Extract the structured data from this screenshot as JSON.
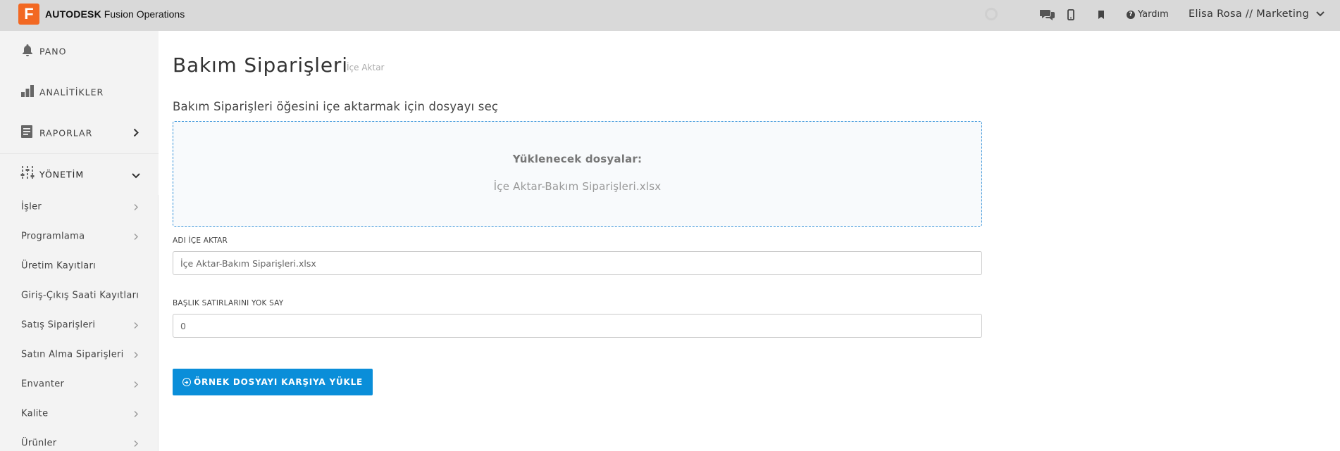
{
  "topbar": {
    "logo_letter": "F",
    "brand_bold": "AUTODESK",
    "brand_product": "Fusion Operations",
    "help_label": "Yardım",
    "user_label": "Elisa Rosa // Marketing",
    "icons": [
      "chat-icon",
      "mobile-icon",
      "bookmark-icon",
      "help-icon",
      "chevron-down-icon"
    ]
  },
  "sidebar": {
    "sections": [
      {
        "label": "PANO",
        "icon": "bell-icon"
      },
      {
        "label": "ANALİTİKLER",
        "icon": "bar-chart-icon"
      },
      {
        "label": "RAPORLAR",
        "icon": "report-icon"
      },
      {
        "label": "YÖNETİM",
        "icon": "sliders-icon"
      }
    ],
    "items": [
      {
        "label": "İşler",
        "chevron": true
      },
      {
        "label": "Programlama",
        "chevron": true
      },
      {
        "label": "Üretim Kayıtları",
        "chevron": false
      },
      {
        "label": "Giriş-Çıkış Saati Kayıtları",
        "chevron": false
      },
      {
        "label": "Satış Siparişleri",
        "chevron": true
      },
      {
        "label": "Satın Alma Siparişleri",
        "chevron": true
      },
      {
        "label": "Envanter",
        "chevron": true
      },
      {
        "label": "Kalite",
        "chevron": true
      },
      {
        "label": "Ürünler",
        "chevron": true
      }
    ]
  },
  "main": {
    "title": "Bakım Siparişleri",
    "subtitle": "İçe Aktar",
    "select_prompt": "Bakım Siparişleri öğesini içe aktarmak için dosyayı seç",
    "dropzone": {
      "title": "Yüklenecek dosyalar:",
      "file_name": "İçe Aktar-Bakım Siparişleri.xlsx"
    },
    "import_name": {
      "label": "ADI İÇE AKTAR",
      "value": "İçe Aktar-Bakım Siparişleri.xlsx"
    },
    "skip_headers": {
      "label": "BAŞLIK SATIRLARINI YOK SAY",
      "value": "0"
    },
    "upload_button": "ÖRNEK DOSYAYI KARŞIYA YÜKLE"
  },
  "colors": {
    "brand_orange": "#f26822",
    "primary_blue": "#0a8ed9",
    "dropzone_border": "#2f8fd8",
    "topbar_bg": "#d9d9d9",
    "sidebar_bg": "#f3f3f3"
  }
}
